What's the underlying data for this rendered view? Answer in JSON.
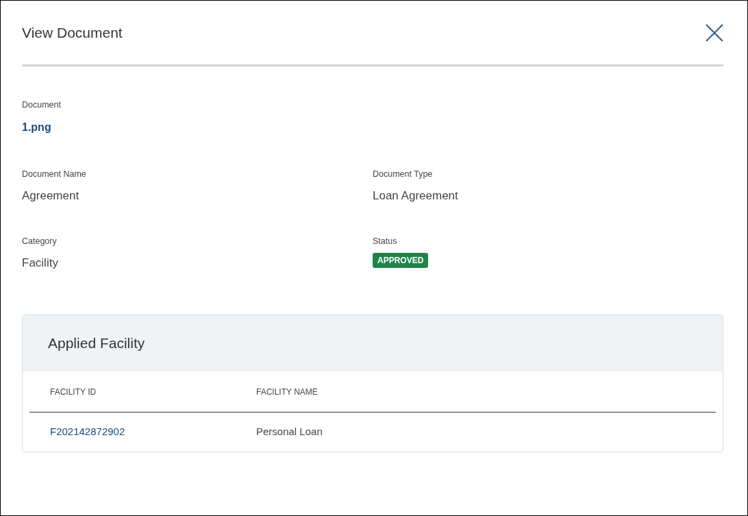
{
  "dialog": {
    "title": "View Document"
  },
  "fields": [
    {
      "label": "Document",
      "value": "1.png",
      "kind": "link"
    },
    {
      "label": "Document Name",
      "value": "Agreement",
      "kind": "text"
    },
    {
      "label": "Document Type",
      "value": "Loan Agreement",
      "kind": "text"
    },
    {
      "label": "Category",
      "value": "Facility",
      "kind": "text"
    },
    {
      "label": "Status",
      "value": "APPROVED",
      "kind": "badge"
    }
  ],
  "applied_facility": {
    "title": "Applied Facility",
    "columns": [
      "FACILITY ID",
      "FACILITY NAME"
    ],
    "rows": [
      {
        "facility_id": "F202142872902",
        "facility_name": "Personal Loan"
      }
    ]
  }
}
